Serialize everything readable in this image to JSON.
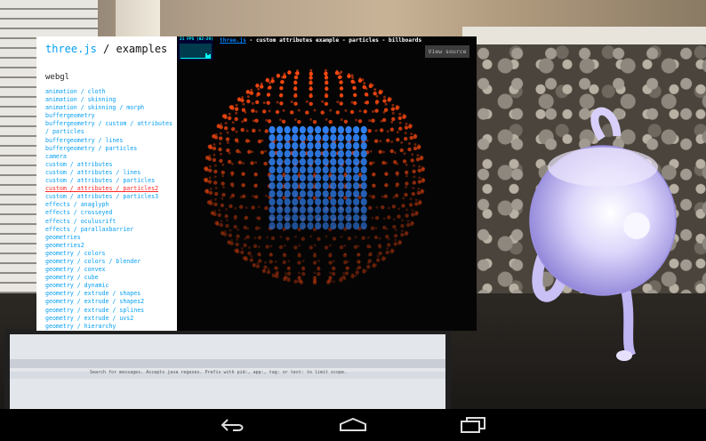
{
  "sidebar": {
    "title_brand": "three.js",
    "title_rest": " / examples",
    "section": "webgl",
    "links": [
      "animation / cloth",
      "animation / skinning",
      "animation / skinning / morph",
      "buffergeometry",
      "buffergeometry / custom / attributes",
      "/ particles",
      "buffergeometry / lines",
      "buffergeometry / particles",
      "camera",
      "custom / attributes",
      "custom / attributes / lines",
      "custom / attributes / particles",
      "custom / attributes / particles2",
      "custom / attributes / particles3",
      "effects / anaglyph",
      "effects / crosseyed",
      "effects / oculusrift",
      "effects / parallaxbarrier",
      "geometries",
      "geometries2",
      "geometry / colors",
      "geometry / colors / blender",
      "geometry / convex",
      "geometry / cube",
      "geometry / dynamic",
      "geometry / extrude / shapes",
      "geometry / extrude / shapes2",
      "geometry / extrude / splines",
      "geometry / extrude / uvs2",
      "geometry / hierarchy"
    ],
    "active_link": "custom / attributes / particles2"
  },
  "viewer": {
    "fps_text": "21 FPS (02-29)",
    "info_link": "three.js",
    "info_text": " - custom attributes example - particles - billboards",
    "view_source": "View source"
  },
  "background": {
    "monitor_text": "Search for messages. Accepts java regexes. Prefix with pid:, app:, tag: or text: to limit scope."
  },
  "colors": {
    "link": "#049ef4",
    "active_link": "#ff2a2a",
    "sphere_particle": "#ff4a10",
    "cube_particle": "#2f7ff0",
    "teapot": "#b9aef0"
  },
  "icons": [
    "back-icon",
    "home-icon",
    "recents-icon"
  ]
}
